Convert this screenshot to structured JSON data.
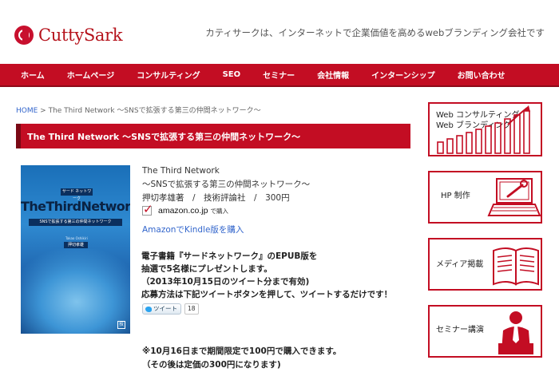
{
  "header": {
    "brand": "CuttySark",
    "tagline": "カティサークは、インターネットで企業価値を高めるwebブランディング会社です"
  },
  "nav": {
    "items": [
      "ホーム",
      "ホームページ",
      "コンサルティング",
      "SEO",
      "セミナー",
      "会社情報",
      "インターンシップ",
      "お問い合わせ"
    ]
  },
  "breadcrumb": {
    "home": "HOME",
    "separator": " > ",
    "current": "The Third Network 〜SNSで拡張する第三の仲間ネットワーク〜"
  },
  "page": {
    "title": "The Third Network 〜SNSで拡張する第三の仲間ネットワーク〜"
  },
  "book": {
    "cover": {
      "publisher_label": "サード ネットワーク",
      "title": "TheThirdNetwork",
      "subtitle": "SNSで拡張する第三の仲間ネットワーク",
      "author_label": "Takao Oshikiri",
      "author": "押切孝雄",
      "publisher_mark": "技"
    },
    "title": "The Third Network",
    "subtitle": "〜SNSで拡張する第三の仲間ネットワーク〜",
    "meta": "押切孝雄著　/　技術評論社　/　300円",
    "amazon_logo": "amazon.co.jp",
    "amazon_buy": "で購入",
    "kindle_link": "AmazonでKindle版を購入"
  },
  "promo": {
    "lines": [
      "電子書籍『サードネットワーク』のEPUB版を",
      "抽選で5名様にプレゼントします。",
      "（2013年10月15日のツイート分まで有効)",
      "応募方法は下記ツイートボタンを押して、ツイートするだけです！"
    ]
  },
  "tweet": {
    "label": "ツイート",
    "count": "18"
  },
  "note": {
    "lines": [
      "※10月16日まで期間限定で100円で購入できます。",
      "（その後は定価の300円になります)"
    ]
  },
  "sidebar": {
    "cards": [
      {
        "label_lines": [
          "Web コンサルティング",
          "Web ブランディング"
        ]
      },
      {
        "label_lines": [
          "HP 制作"
        ]
      },
      {
        "label_lines": [
          "メディア掲載"
        ]
      },
      {
        "label_lines": [
          "セミナー講演"
        ]
      }
    ]
  },
  "colors": {
    "brand_red": "#c30d23",
    "link_blue": "#3366cc"
  }
}
